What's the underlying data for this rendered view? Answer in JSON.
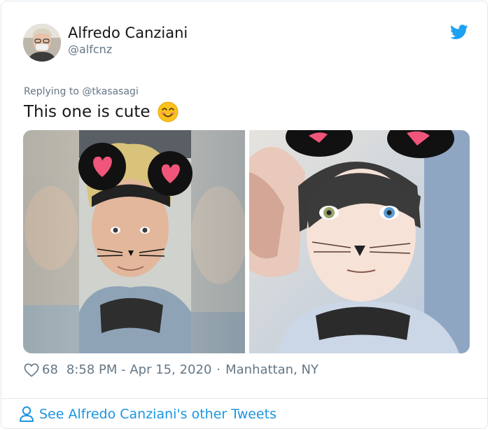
{
  "author": {
    "name": "Alfredo Canziani",
    "handle": "@alfcnz",
    "avatar_icon": "avatar-photo"
  },
  "brand": {
    "icon": "twitter-bird-icon",
    "color": "#1da1f2"
  },
  "tweet": {
    "replying_to": "Replying to @tkasasagi",
    "text": "This one is cute",
    "emoji": "smiling-face-with-smiling-eyes"
  },
  "media": [
    {
      "icon": "photo-real-selfie-with-mouse-ears-filter"
    },
    {
      "icon": "photo-anime-style-with-mouse-ears-filter"
    }
  ],
  "meta": {
    "likes": "68",
    "time": "8:58 PM - Apr 15, 2020",
    "separator": "·",
    "location": "Manhattan, NY"
  },
  "footer": {
    "link": "See Alfredo Canziani's other Tweets",
    "icon": "person-icon",
    "color": "#1b95e0"
  }
}
